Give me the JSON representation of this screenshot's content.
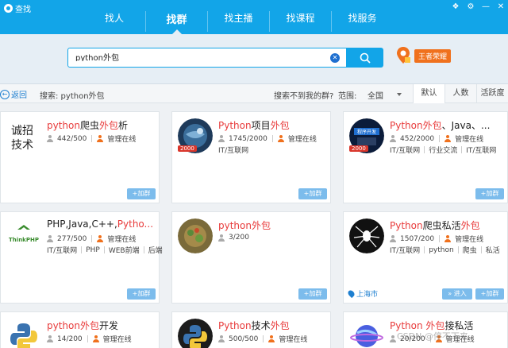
{
  "app": {
    "title": "查找"
  },
  "nav": {
    "tabs": [
      "找人",
      "找群",
      "找主播",
      "找课程",
      "找服务"
    ],
    "active": 1
  },
  "search": {
    "value": "python外包",
    "glory_badge": "王者荣耀"
  },
  "filter": {
    "back_label": "返回",
    "search_label": "搜索: python外包",
    "no_group_link": "搜索不到我的群?",
    "range_label": "范围:",
    "range_value": "全国",
    "sort_tabs": [
      "默认",
      "人数",
      "活跃度"
    ]
  },
  "cards": [
    {
      "name_parts": [
        [
          "python",
          true
        ],
        [
          "爬虫",
          false
        ],
        [
          "外包",
          true
        ],
        [
          "析",
          false
        ]
      ],
      "members": "442/500",
      "admin": "管理在线",
      "tags": [],
      "add": "+加群"
    },
    {
      "name_parts": [
        [
          "Python",
          true
        ],
        [
          "项目",
          false
        ],
        [
          "外包",
          true
        ]
      ],
      "members": "1745/2000",
      "admin": "管理在线",
      "tags": [
        "IT/互联网"
      ],
      "level": "2000",
      "add": "+加群"
    },
    {
      "name_parts": [
        [
          "Python",
          true
        ],
        [
          "外包",
          true
        ],
        [
          "、Java、...",
          false
        ]
      ],
      "members": "452/2000",
      "admin": "管理在线",
      "tags": [
        "IT/互联网",
        "行业交流",
        "IT/互联网"
      ],
      "level": "2000",
      "add": "+加群"
    },
    {
      "name_parts": [
        [
          "PHP,Java,C++,",
          false
        ],
        [
          "Pytho...",
          true
        ]
      ],
      "members": "277/500",
      "admin": "管理在线",
      "tags": [
        "IT/互联网",
        "PHP",
        "WEB前端",
        "后端"
      ],
      "add": "+加群"
    },
    {
      "name_parts": [
        [
          "python",
          true
        ],
        [
          "外包",
          true
        ]
      ],
      "members": "3/200",
      "admin": "",
      "tags": [],
      "add": "+加群"
    },
    {
      "name_parts": [
        [
          "Python",
          true
        ],
        [
          "爬虫私活",
          false
        ],
        [
          "外包",
          true
        ]
      ],
      "members": "1507/200",
      "admin": "管理在线",
      "tags": [
        "IT/互联网",
        "python",
        "爬虫",
        "私活"
      ],
      "location": "上海市",
      "enter": "» 进入",
      "add": "+加群"
    },
    {
      "name_parts": [
        [
          "python",
          true
        ],
        [
          "外包",
          true
        ],
        [
          "开发",
          false
        ]
      ],
      "members": "14/200",
      "admin": "管理在线",
      "tags": [],
      "add": ""
    },
    {
      "name_parts": [
        [
          "Python",
          true
        ],
        [
          "技术",
          false
        ],
        [
          "外包",
          true
        ]
      ],
      "members": "500/500",
      "admin": "管理在线",
      "tags": [],
      "add": ""
    },
    {
      "name_parts": [
        [
          "Python ",
          true
        ],
        [
          "外包",
          true
        ],
        [
          "接私活",
          false
        ]
      ],
      "members": "20/200",
      "admin": "管理在线",
      "tags": [],
      "add": ""
    }
  ],
  "avatar_texts": {
    "card0": "诚招技术",
    "card3": "ThinkPHP",
    "card2": "程序开发"
  },
  "watermark": "CSDN @停不下来"
}
